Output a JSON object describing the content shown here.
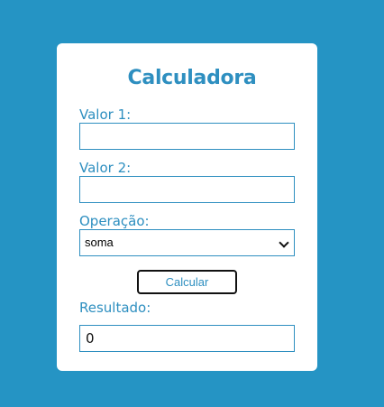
{
  "app": {
    "title": "Calculadora"
  },
  "form": {
    "valor1": {
      "label": "Valor 1:",
      "value": ""
    },
    "valor2": {
      "label": "Valor 2:",
      "value": ""
    },
    "operacao": {
      "label": "Operação:",
      "selected": "soma"
    },
    "calc_button_label": "Calcular",
    "resultado": {
      "label": "Resultado:",
      "value": "0"
    }
  },
  "colors": {
    "background": "#2594c4",
    "accent": "#2e8fc0",
    "card": "#ffffff"
  }
}
